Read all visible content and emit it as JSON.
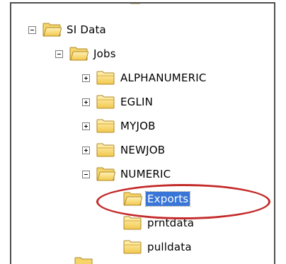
{
  "tree": {
    "root": {
      "label": "SI Data",
      "toggle": "minus",
      "icon": "folder-open-icon"
    },
    "jobs": {
      "label": "Jobs",
      "toggle": "minus",
      "icon": "folder-open-icon"
    },
    "children": [
      {
        "label": "ALPHANUMERIC",
        "toggle": "plus",
        "icon": "folder-icon"
      },
      {
        "label": "EGLIN",
        "toggle": "plus",
        "icon": "folder-icon"
      },
      {
        "label": "MYJOB",
        "toggle": "plus",
        "icon": "folder-icon"
      },
      {
        "label": "NEWJOB",
        "toggle": "plus",
        "icon": "folder-icon"
      },
      {
        "label": "NUMERIC",
        "toggle": "minus",
        "icon": "folder-open-icon"
      }
    ],
    "numeric_children": [
      {
        "label": "Exports",
        "selected": true,
        "icon": "folder-open-icon"
      },
      {
        "label": "prntdata",
        "icon": "folder-icon"
      },
      {
        "label": "pulldata",
        "icon": "folder-icon"
      }
    ]
  },
  "colors": {
    "folder_fill": "#f7d774",
    "folder_edge": "#b08a2a",
    "selection": "#3875d7",
    "highlight_ellipse": "#c42b2b"
  }
}
